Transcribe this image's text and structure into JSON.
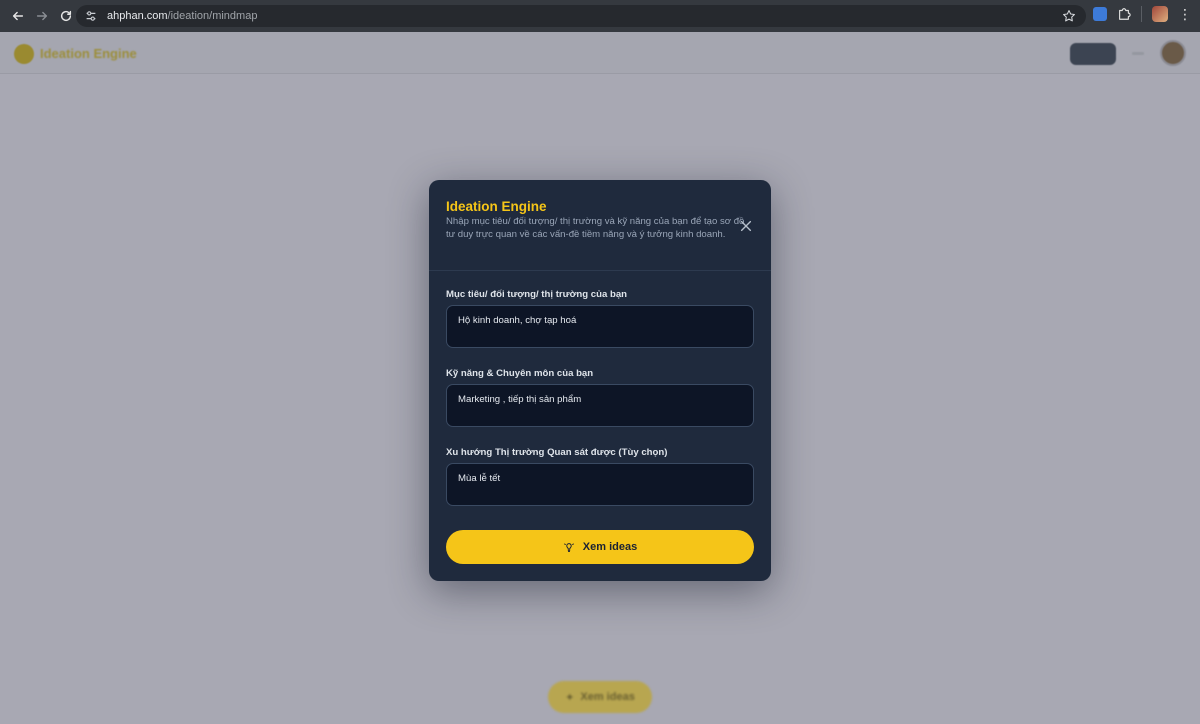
{
  "browser": {
    "url_host": "ahphan.com",
    "url_path": "/ideation/mindmap"
  },
  "app": {
    "title": "Ideation Engine",
    "bottom_button_label": "Xem ideas"
  },
  "modal": {
    "title": "Ideation Engine",
    "description": "Nhập mục tiêu/ đối tượng/ thị trường và kỹ năng của bạn để tạo sơ đồ tư duy trực quan về các vấn-đề tiềm năng và ý tưởng kinh doanh.",
    "fields": [
      {
        "label": "Mục tiêu/ đối tượng/ thị trường của bạn",
        "value": "Hộ kinh doanh, chợ tạp hoá"
      },
      {
        "label": "Kỹ năng & Chuyên môn của bạn",
        "value": "Marketing , tiếp thị sản phẩm"
      },
      {
        "label": "Xu hướng Thị trường Quan sát được (Tùy chọn)",
        "value": "Mùa lễ tết"
      }
    ],
    "submit_label": "Xem ideas"
  },
  "colors": {
    "accent": "#f5c518",
    "modal_bg": "#1f2a3d",
    "input_bg": "#0d1526",
    "overlay": "#a8a8b3"
  }
}
